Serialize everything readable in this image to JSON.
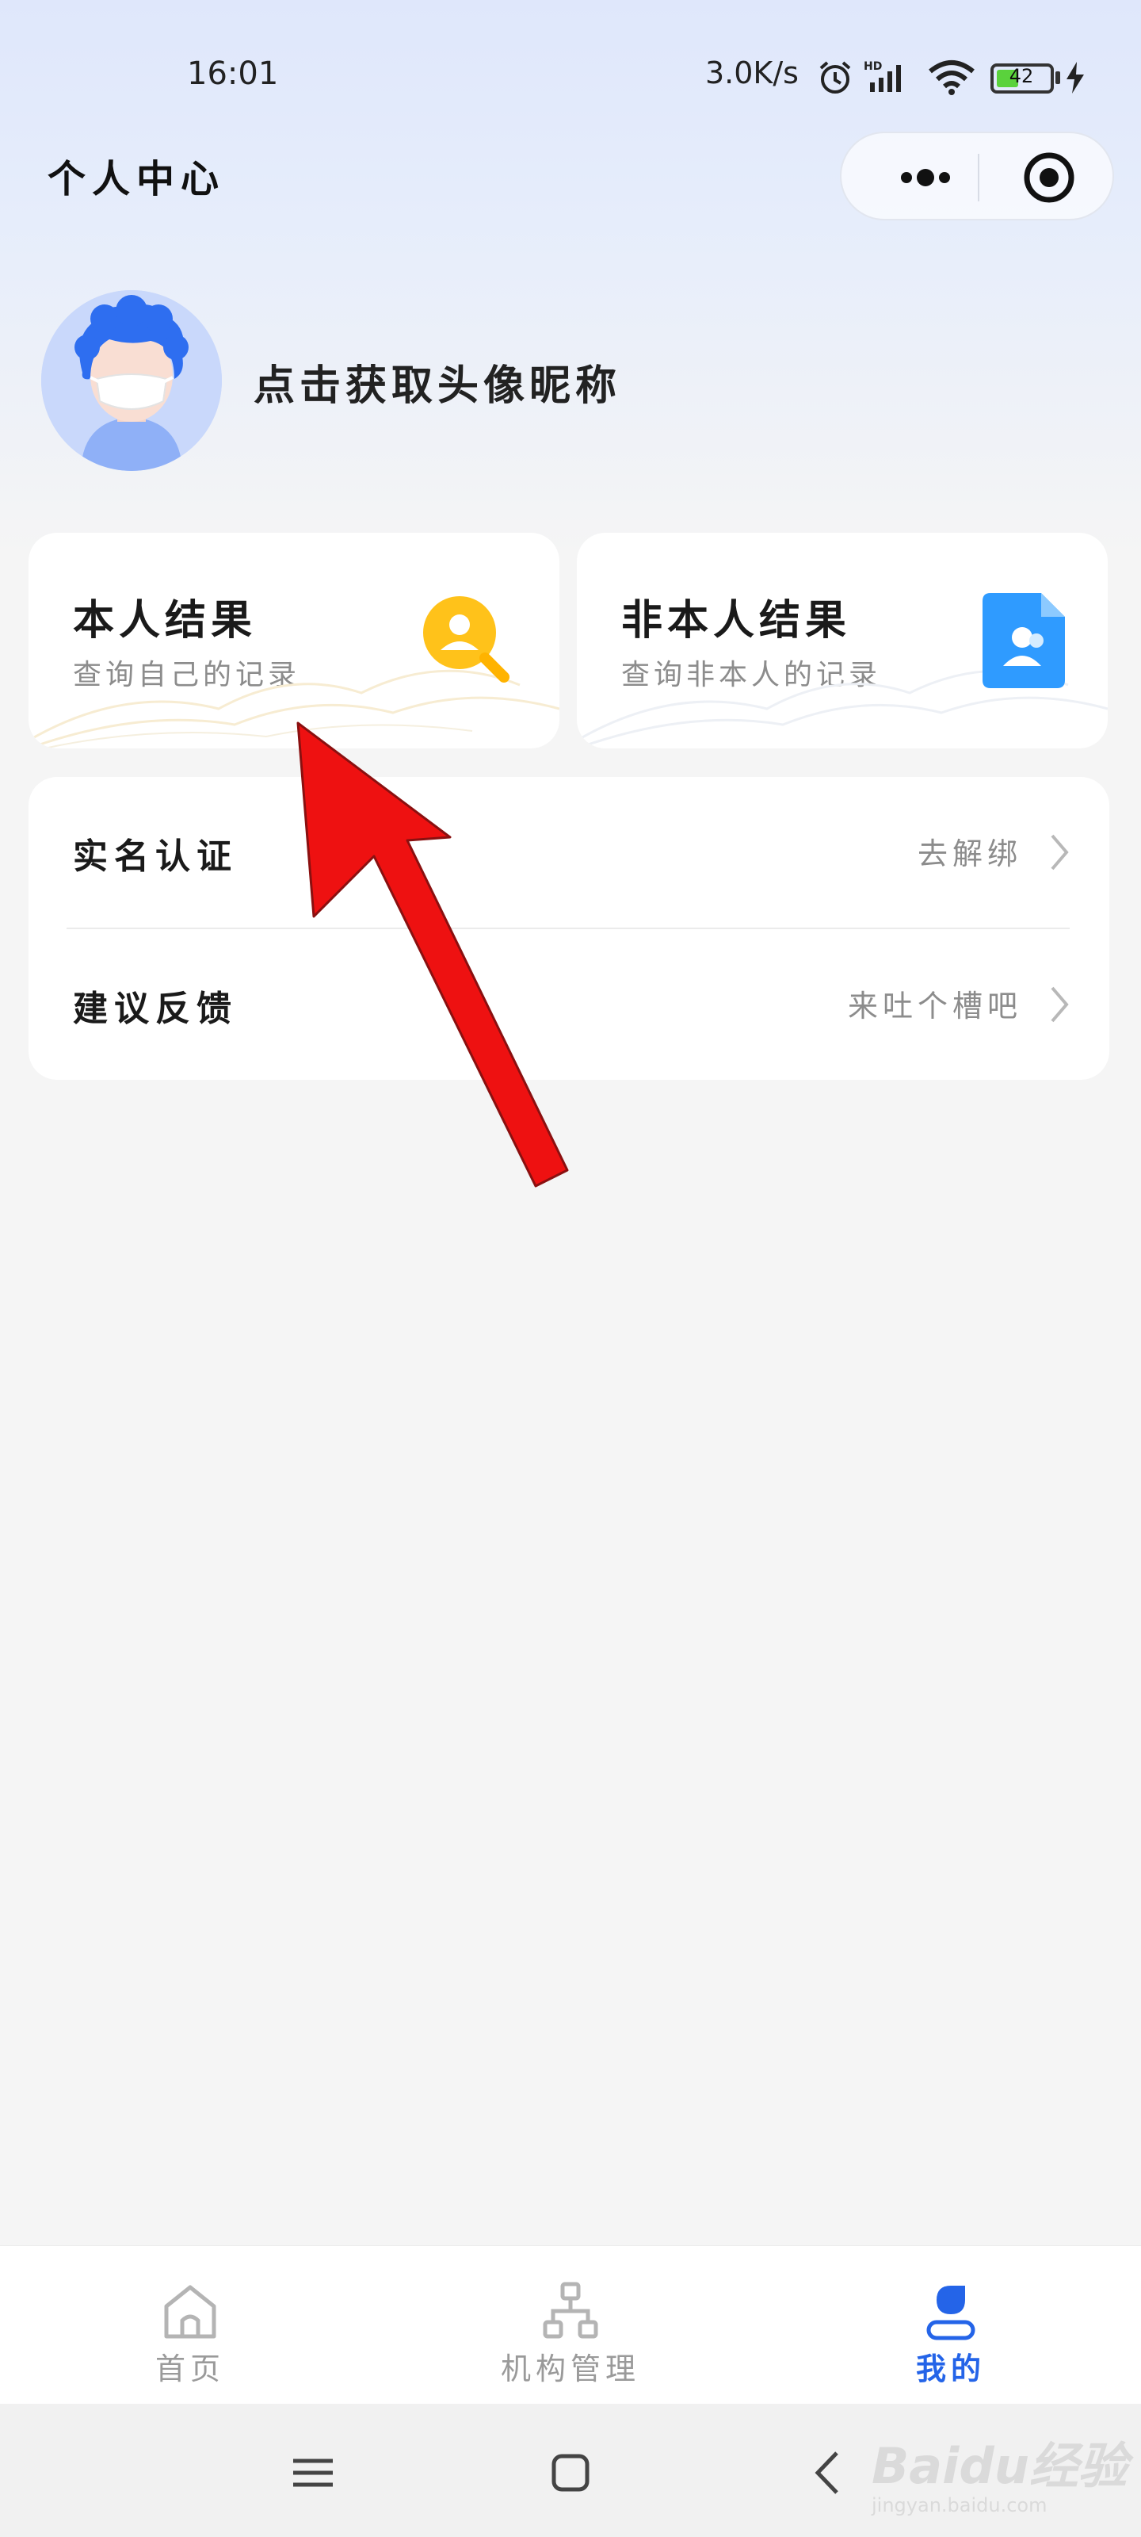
{
  "status_bar": {
    "time": "16:01",
    "net_speed": "3.0K/s",
    "battery": "42",
    "battery_level": 0.42,
    "icons": [
      "alarm-icon",
      "hd-signal-icon",
      "wifi-icon",
      "battery-icon",
      "charging-icon"
    ]
  },
  "header": {
    "title": "个人中心",
    "capsule": {
      "more_icon": "more-dots-icon",
      "close_icon": "target-close-icon"
    }
  },
  "profile": {
    "nickname_prompt": "点击获取头像昵称",
    "avatar_icon": "avatar-masked-person"
  },
  "cards": [
    {
      "title": "本人结果",
      "subtitle": "查询自己的记录",
      "icon": "search-person-icon",
      "accent": "#ffc21a"
    },
    {
      "title": "非本人结果",
      "subtitle": "查询非本人的记录",
      "icon": "contact-document-icon",
      "accent": "#2f9bff"
    }
  ],
  "list": {
    "items": [
      {
        "label": "实名认证",
        "value": "去解绑"
      },
      {
        "label": "建议反馈",
        "value": "来吐个槽吧"
      }
    ]
  },
  "annotation": {
    "color": "#ee1111"
  },
  "tab_bar": {
    "tabs": [
      {
        "label": "首页",
        "icon": "home-icon",
        "active": false
      },
      {
        "label": "机构管理",
        "icon": "org-chart-icon",
        "active": false
      },
      {
        "label": "我的",
        "icon": "user-icon",
        "active": true
      }
    ],
    "active_color": "#2464e8",
    "inactive_color": "#9a9a9a"
  },
  "system_nav": {
    "icons": [
      "menu-icon",
      "home-square-icon",
      "back-icon"
    ]
  },
  "watermark": {
    "text": "Baidu经验",
    "sub": "jingyan.baidu.com"
  }
}
